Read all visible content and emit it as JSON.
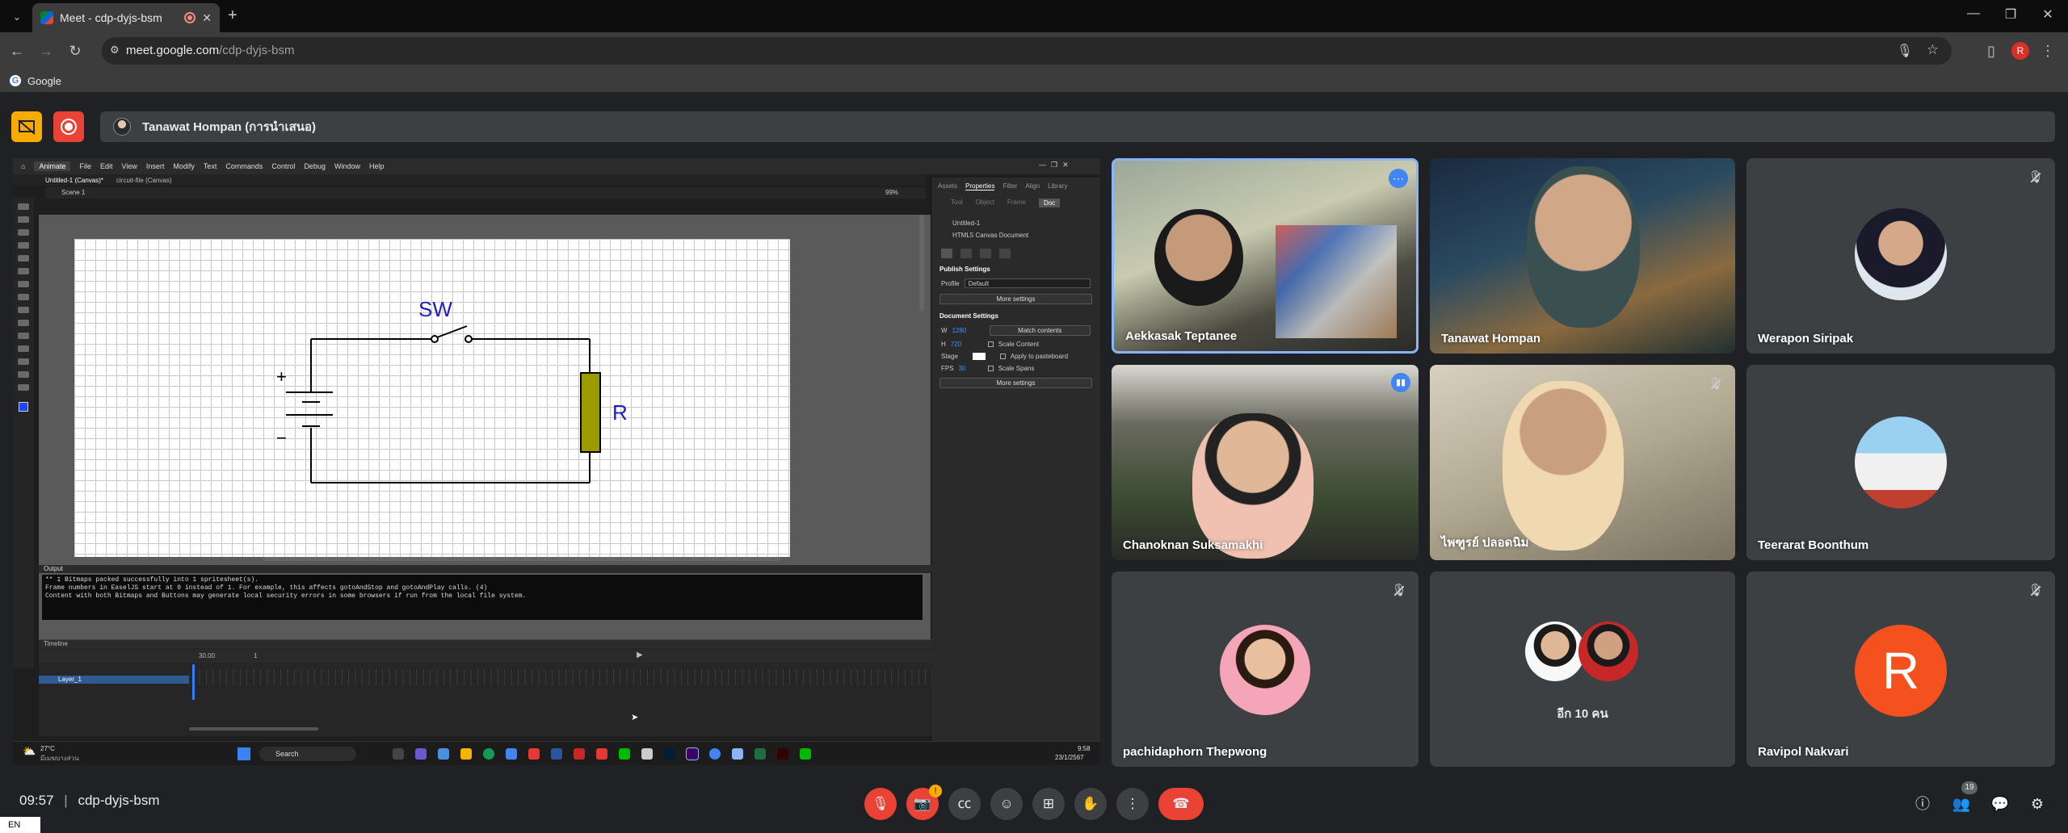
{
  "browser": {
    "tab_title": "Meet - cdp-dyjs-bsm",
    "url_host": "meet.google.com",
    "url_path": "/cdp-dyjs-bsm",
    "bookmark": "Google",
    "profile_initial": "R"
  },
  "meet_header": {
    "presenter": "Tanawat Hompan (การนำเสนอ)"
  },
  "animate": {
    "app_label": "Animate",
    "menus": [
      "File",
      "Edit",
      "View",
      "Insert",
      "Modify",
      "Text",
      "Commands",
      "Control",
      "Debug",
      "Window",
      "Help"
    ],
    "doc_tabs": [
      "Untitled-1 (Canvas)*",
      "circuit-file (Canvas)"
    ],
    "scene": "Scene 1",
    "zoom": "99%",
    "circuit": {
      "switch_label": "SW",
      "resistor_label": "R",
      "plus": "+",
      "minus": "−"
    },
    "props": {
      "tabs": [
        "Assets",
        "Properties",
        "Filter",
        "Align",
        "Library"
      ],
      "subtabs": [
        "Tool",
        "Object",
        "Frame",
        "Doc"
      ],
      "doc_name": "Untitled-1",
      "doc_type": "HTML5 Canvas Document",
      "publish_header": "Publish Settings",
      "profile_label": "Profile",
      "profile_value": "Default",
      "more_settings": "More settings",
      "doc_settings_header": "Document Settings",
      "w_label": "W",
      "w_value": "1280",
      "h_label": "H",
      "h_value": "720",
      "match_contents": "Match contents",
      "scale_content": "Scale Content",
      "stage_label": "Stage",
      "apply_pasteboard": "Apply to pasteboard",
      "fps_label": "FPS",
      "fps_value": "30",
      "scale_spans": "Scale Spans"
    },
    "output_label": "Output",
    "output_lines": [
      "** 1 Bitmaps packed successfully into 1 spritesheet(s).",
      "Frame numbers in EaselJS start at 0 instead of 1. For example, this affects gotoAndStop and gotoAndPlay calls. (4)",
      "Content with both Bitmaps and Buttons may generate local security errors in some browsers if run from the local file system."
    ],
    "timeline_label": "Timeline",
    "layer_name": "Layer_1",
    "fps_display": "30.00",
    "frame_display": "1"
  },
  "windows_taskbar": {
    "weather_temp": "27°C",
    "weather_text": "มีเมฆบางส่วน",
    "search": "Search",
    "time": "9:58",
    "date": "23/1/2567"
  },
  "participants": [
    {
      "name": "Aekkasak Teptanee"
    },
    {
      "name": "Tanawat Hompan"
    },
    {
      "name": "Werapon Siripak"
    },
    {
      "name": "Chanoknan Suksamakhi"
    },
    {
      "name": "ไพฑูรย์ ปลอดนิม"
    },
    {
      "name": "Teerarat Boonthum"
    },
    {
      "name": "pachidaphorn Thepwong"
    },
    {
      "name": "อีก 10 คน"
    },
    {
      "name": "Ravipol Nakvari",
      "initial": "R"
    }
  ],
  "bottom": {
    "time": "09:57",
    "meeting_code": "cdp-dyjs-bsm",
    "people_count": "19",
    "alert_badge": "!",
    "lang": "EN"
  }
}
